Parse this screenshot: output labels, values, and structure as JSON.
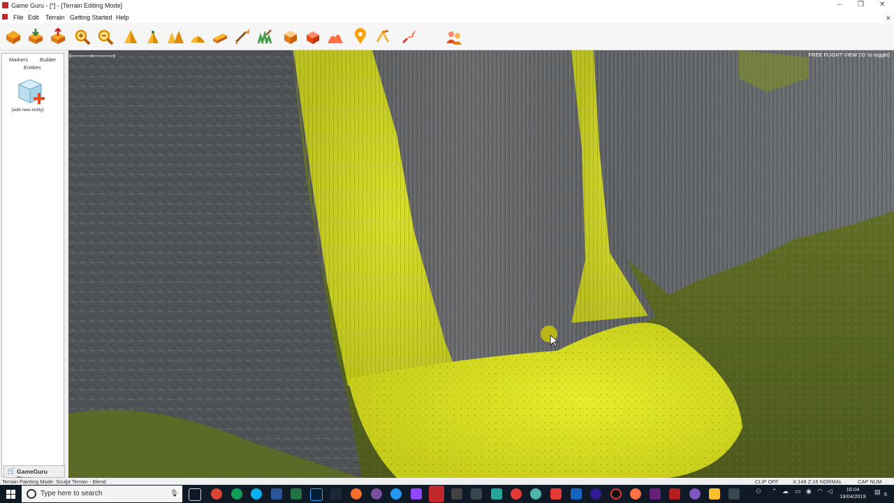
{
  "window": {
    "title": "Game Guru - [*] - [Terrain Editing Mode]",
    "minimize": "–",
    "maximize": "❐",
    "close": "✕",
    "doc_close": "✕"
  },
  "menu": {
    "items": [
      "File",
      "Edit",
      "Terrain",
      "Getting Started",
      "Help"
    ]
  },
  "toolbar": {
    "icons": [
      "new-level-icon",
      "open-level-icon",
      "save-level-icon",
      "zoom-in-icon",
      "zoom-out-icon",
      "raise-terrain-icon",
      "lower-terrain-icon",
      "flatten-terrain-icon",
      "blend-terrain-icon",
      "ramp-terrain-icon",
      "paint-terrain-icon",
      "paint-grass-icon",
      "entity-mode-icon",
      "marker-mode-icon",
      "test-game-icon",
      "waypoint-icon",
      "social-vr-icon",
      "test-level-icon",
      "build-game-icon"
    ]
  },
  "panel": {
    "tab_markers": "Markers",
    "tab_builder": "Builder",
    "tab_entities": "Entities",
    "add_entity_label": "[add new entity]",
    "store_label": "GameGuru Store",
    "store_icon": "cart-icon"
  },
  "viewport": {
    "overlay_text": "FREE FLIGHT VIEW ('G' to toggle)"
  },
  "statusbar": {
    "mode_text": "Terrain Painting Mode: Sculpt Terrain - Blend",
    "clip": "CLIP OFF",
    "coords": "X:148 Z:16 NORMAL",
    "keys": "CAP NUM SCRL"
  },
  "taskbar": {
    "search_placeholder": "Type here to search",
    "time": "16:04",
    "date": "19/04/2019",
    "notification_count": "5"
  },
  "colors": {
    "accent": "#c0282d",
    "highlight": "#d8dd20",
    "taskbar": "#101a26"
  }
}
